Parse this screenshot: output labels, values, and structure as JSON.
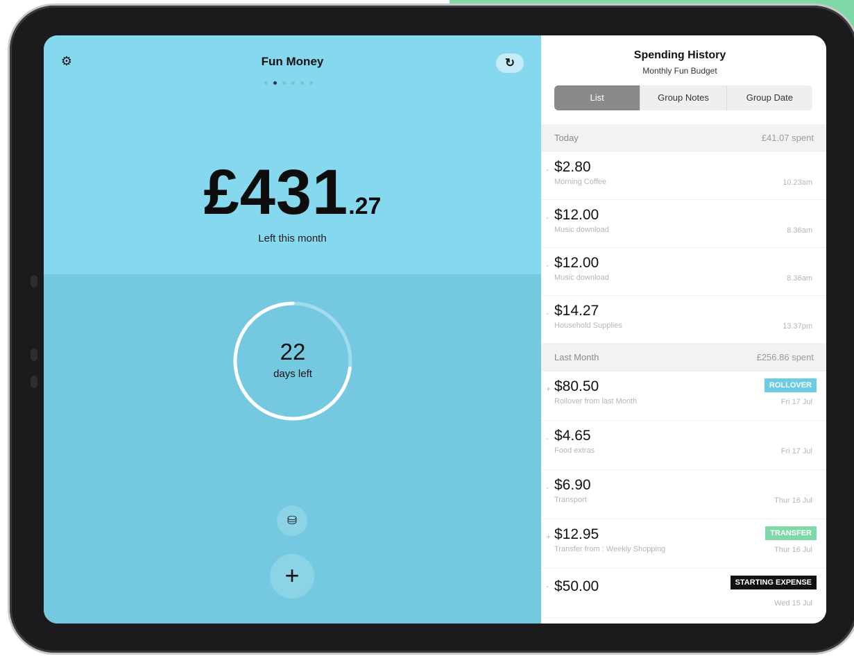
{
  "left": {
    "title": "Fun Money",
    "amount_main": "£431",
    "amount_cents": ".27",
    "amount_label": "Left this month",
    "days_count": "22",
    "days_label": "days left",
    "days_progress_fraction": 0.27,
    "page_dots": {
      "count": 6,
      "active_index": 1
    },
    "icons": {
      "settings": "gear-icon",
      "refresh": "refresh-icon",
      "database": "database-icon",
      "add": "plus-icon"
    },
    "add_glyph": "+"
  },
  "right": {
    "title": "Spending History",
    "subtitle": "Monthly Fun Budget",
    "segments": [
      "List",
      "Group Notes",
      "Group Date"
    ],
    "selected_segment": "List",
    "sections": [
      {
        "label": "Today",
        "total": "£41.07 spent",
        "items": [
          {
            "sign": "-",
            "amount": "$2.80",
            "note": "Morning Coffee",
            "time": "10.23am",
            "badge": ""
          },
          {
            "sign": "-",
            "amount": "$12.00",
            "note": "Music download",
            "time": "8.36am",
            "badge": ""
          },
          {
            "sign": "-",
            "amount": "$12.00",
            "note": "Music download",
            "time": "8.36am",
            "badge": ""
          },
          {
            "sign": "-",
            "amount": "$14.27",
            "note": "Household Supplies",
            "time": "13.37pm",
            "badge": ""
          }
        ]
      },
      {
        "label": "Last Month",
        "total": "£256.86 spent",
        "items": [
          {
            "sign": "+",
            "amount": "$80.50",
            "note": "Rollover from last Month",
            "time": "Fri 17 Jul",
            "badge": "ROLLOVER"
          },
          {
            "sign": "-",
            "amount": "$4.65",
            "note": "Food extras",
            "time": "Fri 17 Jul",
            "badge": ""
          },
          {
            "sign": "-",
            "amount": "$6.90",
            "note": "Transport",
            "time": "Thur 16 Jul",
            "badge": ""
          },
          {
            "sign": "+",
            "amount": "$12.95",
            "note": "Transfer from : Weekly Shopping",
            "time": "Thur 16 Jul",
            "badge": "TRANSFER"
          },
          {
            "sign": "-",
            "amount": "$50.00",
            "note": "",
            "time": "Wed 15 Jul",
            "badge": "STARTING EXPENSE"
          }
        ]
      }
    ]
  },
  "colors": {
    "top_panel": "#86d8ee",
    "bottom_panel": "#74c9e1",
    "rollover_badge": "#6ccbe5",
    "transfer_badge": "#7ed9a6",
    "starting_badge": "#111111",
    "segment_active": "#8a8a8a"
  }
}
